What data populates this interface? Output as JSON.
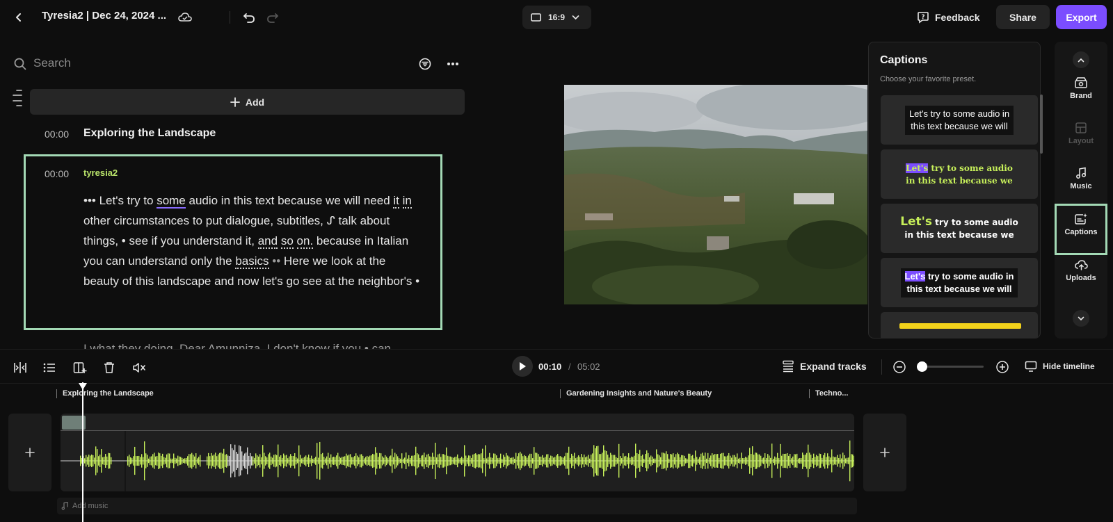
{
  "topbar": {
    "project_title": "Tyresia2 | Dec 24, 2024 ...",
    "aspect_ratio": "16:9",
    "feedback_label": "Feedback",
    "share_label": "Share",
    "export_label": "Export",
    "export_color": "#7b4dff"
  },
  "transcript_panel": {
    "search_placeholder": "Search",
    "add_label": "Add",
    "chapter": {
      "time": "00:00",
      "title": "Exploring the Landscape"
    },
    "segment": {
      "time": "00:00",
      "speaker": "tyresia2",
      "text_parts": [
        "••• Let's try to ",
        "some",
        " audio in this text because we will need ",
        "it",
        " ",
        "in",
        " other circumstances to put dialogue, subtitles, ",
        "ᔑ",
        " talk about things, • see if you understand it, ",
        "and",
        " ",
        "so",
        " ",
        "on.",
        " because in Italian you can understand only the ",
        "basics",
        " ",
        "••",
        " Here we look at the beauty of this landscape and now let's go see at the neighbor's •"
      ]
    },
    "next_text": "I what they doing. Dear Amunniza, I don't know if you • can"
  },
  "captions": {
    "title": "Captions",
    "subtitle": "Choose your favorite preset.",
    "presets": [
      {
        "line1": "Let's try to some audio in",
        "line2": "this text because we will"
      },
      {
        "highlight": "Let's",
        "line1": " try to some audio",
        "line2": "in this text because we"
      },
      {
        "highlight": "Let's",
        "line1": " try to some audio",
        "line2": "in this text because we"
      },
      {
        "highlight": "Let's",
        "line1": " try to some audio in",
        "line2": "this text because we will"
      }
    ]
  },
  "rail": {
    "items": [
      {
        "label": "Brand",
        "icon": "brand-icon"
      },
      {
        "label": "Layout",
        "icon": "layout-icon"
      },
      {
        "label": "Music",
        "icon": "music-icon"
      },
      {
        "label": "Captions",
        "icon": "captions-icon"
      },
      {
        "label": "Uploads",
        "icon": "uploads-icon"
      }
    ]
  },
  "toolbar": {
    "current_time": "00:10",
    "separator": "/",
    "total_time": "05:02",
    "expand_tracks_label": "Expand tracks",
    "hide_timeline_label": "Hide timeline",
    "zoom_level": 0.0
  },
  "timeline": {
    "chapters": [
      "Exploring the Landscape",
      "Gardening Insights and Nature's Beauty",
      "Techno..."
    ],
    "add_music_label": "Add music",
    "waveform_color": "#c7f05a"
  }
}
